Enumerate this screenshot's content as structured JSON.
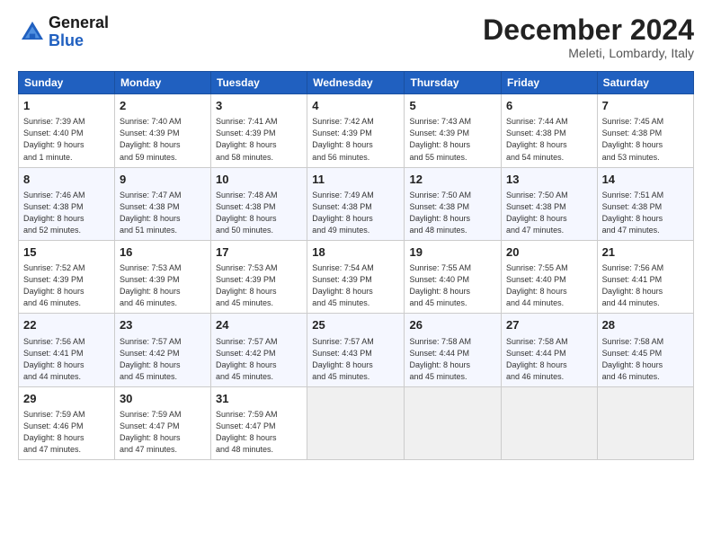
{
  "header": {
    "logo_line1": "General",
    "logo_line2": "Blue",
    "month": "December 2024",
    "location": "Meleti, Lombardy, Italy"
  },
  "weekdays": [
    "Sunday",
    "Monday",
    "Tuesday",
    "Wednesday",
    "Thursday",
    "Friday",
    "Saturday"
  ],
  "weeks": [
    [
      {
        "day": 1,
        "info": "Sunrise: 7:39 AM\nSunset: 4:40 PM\nDaylight: 9 hours\nand 1 minute."
      },
      {
        "day": 2,
        "info": "Sunrise: 7:40 AM\nSunset: 4:39 PM\nDaylight: 8 hours\nand 59 minutes."
      },
      {
        "day": 3,
        "info": "Sunrise: 7:41 AM\nSunset: 4:39 PM\nDaylight: 8 hours\nand 58 minutes."
      },
      {
        "day": 4,
        "info": "Sunrise: 7:42 AM\nSunset: 4:39 PM\nDaylight: 8 hours\nand 56 minutes."
      },
      {
        "day": 5,
        "info": "Sunrise: 7:43 AM\nSunset: 4:39 PM\nDaylight: 8 hours\nand 55 minutes."
      },
      {
        "day": 6,
        "info": "Sunrise: 7:44 AM\nSunset: 4:38 PM\nDaylight: 8 hours\nand 54 minutes."
      },
      {
        "day": 7,
        "info": "Sunrise: 7:45 AM\nSunset: 4:38 PM\nDaylight: 8 hours\nand 53 minutes."
      }
    ],
    [
      {
        "day": 8,
        "info": "Sunrise: 7:46 AM\nSunset: 4:38 PM\nDaylight: 8 hours\nand 52 minutes."
      },
      {
        "day": 9,
        "info": "Sunrise: 7:47 AM\nSunset: 4:38 PM\nDaylight: 8 hours\nand 51 minutes."
      },
      {
        "day": 10,
        "info": "Sunrise: 7:48 AM\nSunset: 4:38 PM\nDaylight: 8 hours\nand 50 minutes."
      },
      {
        "day": 11,
        "info": "Sunrise: 7:49 AM\nSunset: 4:38 PM\nDaylight: 8 hours\nand 49 minutes."
      },
      {
        "day": 12,
        "info": "Sunrise: 7:50 AM\nSunset: 4:38 PM\nDaylight: 8 hours\nand 48 minutes."
      },
      {
        "day": 13,
        "info": "Sunrise: 7:50 AM\nSunset: 4:38 PM\nDaylight: 8 hours\nand 47 minutes."
      },
      {
        "day": 14,
        "info": "Sunrise: 7:51 AM\nSunset: 4:38 PM\nDaylight: 8 hours\nand 47 minutes."
      }
    ],
    [
      {
        "day": 15,
        "info": "Sunrise: 7:52 AM\nSunset: 4:39 PM\nDaylight: 8 hours\nand 46 minutes."
      },
      {
        "day": 16,
        "info": "Sunrise: 7:53 AM\nSunset: 4:39 PM\nDaylight: 8 hours\nand 46 minutes."
      },
      {
        "day": 17,
        "info": "Sunrise: 7:53 AM\nSunset: 4:39 PM\nDaylight: 8 hours\nand 45 minutes."
      },
      {
        "day": 18,
        "info": "Sunrise: 7:54 AM\nSunset: 4:39 PM\nDaylight: 8 hours\nand 45 minutes."
      },
      {
        "day": 19,
        "info": "Sunrise: 7:55 AM\nSunset: 4:40 PM\nDaylight: 8 hours\nand 45 minutes."
      },
      {
        "day": 20,
        "info": "Sunrise: 7:55 AM\nSunset: 4:40 PM\nDaylight: 8 hours\nand 44 minutes."
      },
      {
        "day": 21,
        "info": "Sunrise: 7:56 AM\nSunset: 4:41 PM\nDaylight: 8 hours\nand 44 minutes."
      }
    ],
    [
      {
        "day": 22,
        "info": "Sunrise: 7:56 AM\nSunset: 4:41 PM\nDaylight: 8 hours\nand 44 minutes."
      },
      {
        "day": 23,
        "info": "Sunrise: 7:57 AM\nSunset: 4:42 PM\nDaylight: 8 hours\nand 45 minutes."
      },
      {
        "day": 24,
        "info": "Sunrise: 7:57 AM\nSunset: 4:42 PM\nDaylight: 8 hours\nand 45 minutes."
      },
      {
        "day": 25,
        "info": "Sunrise: 7:57 AM\nSunset: 4:43 PM\nDaylight: 8 hours\nand 45 minutes."
      },
      {
        "day": 26,
        "info": "Sunrise: 7:58 AM\nSunset: 4:44 PM\nDaylight: 8 hours\nand 45 minutes."
      },
      {
        "day": 27,
        "info": "Sunrise: 7:58 AM\nSunset: 4:44 PM\nDaylight: 8 hours\nand 46 minutes."
      },
      {
        "day": 28,
        "info": "Sunrise: 7:58 AM\nSunset: 4:45 PM\nDaylight: 8 hours\nand 46 minutes."
      }
    ],
    [
      {
        "day": 29,
        "info": "Sunrise: 7:59 AM\nSunset: 4:46 PM\nDaylight: 8 hours\nand 47 minutes."
      },
      {
        "day": 30,
        "info": "Sunrise: 7:59 AM\nSunset: 4:47 PM\nDaylight: 8 hours\nand 47 minutes."
      },
      {
        "day": 31,
        "info": "Sunrise: 7:59 AM\nSunset: 4:47 PM\nDaylight: 8 hours\nand 48 minutes."
      },
      {
        "day": null,
        "info": ""
      },
      {
        "day": null,
        "info": ""
      },
      {
        "day": null,
        "info": ""
      },
      {
        "day": null,
        "info": ""
      }
    ]
  ]
}
